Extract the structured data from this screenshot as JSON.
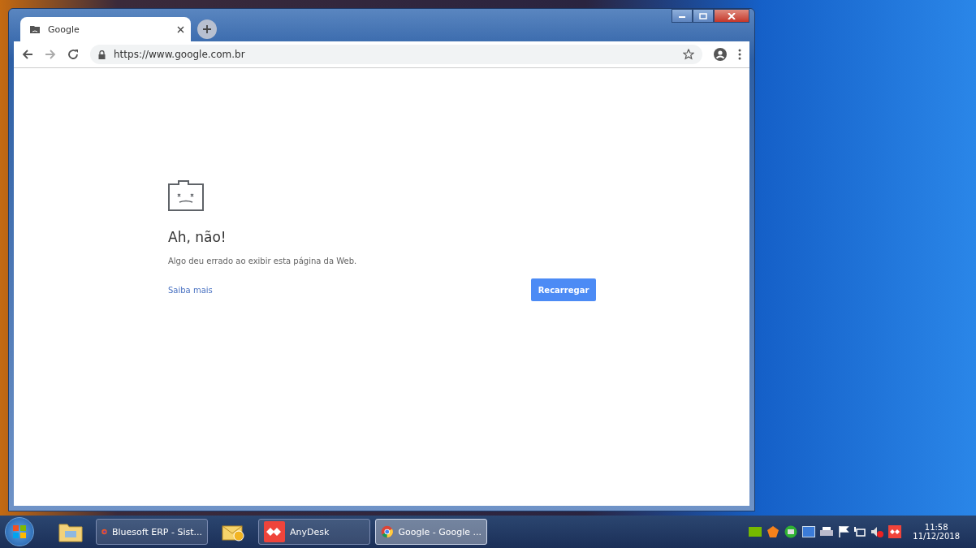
{
  "browser": {
    "tabs": [
      {
        "title": "Google",
        "selected": true
      }
    ],
    "url": "https://www.google.com.br"
  },
  "error_page": {
    "heading": "Ah, não!",
    "message": "Algo deu errado ao exibir esta página da Web.",
    "link": "Saiba mais",
    "button": "Recarregar"
  },
  "taskbar": {
    "buttons": [
      {
        "label": "Bluesoft ERP - Sist...",
        "selected": false
      },
      {
        "label": "AnyDesk",
        "selected": false
      },
      {
        "label": "Google - Google ...",
        "selected": true
      }
    ],
    "clock": {
      "time": "11:58",
      "date": "11/12/2018"
    }
  }
}
